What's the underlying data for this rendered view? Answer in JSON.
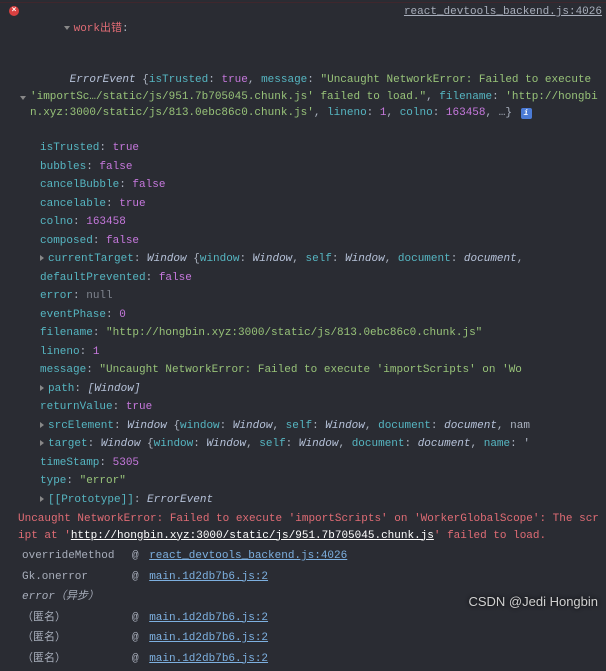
{
  "header": {
    "title": "work出错",
    "source_link": "react_devtools_backend.js:4026"
  },
  "summary": {
    "type_name": "ErrorEvent",
    "inline": "{isTrusted: true, message: \"Uncaught NetworkError: Failed to execute 'importSc…/static/js/951.7b705045.chunk.js' failed to load.\", filename: 'http://hongbin.xyz:3000/static/js/813.0ebc86c0.chunk.js', lineno: 1, colno: 163458, …}"
  },
  "props": {
    "isTrusted": "true",
    "bubbles": "false",
    "cancelBubble": "false",
    "cancelable": "true",
    "colno": "163458",
    "composed": "false",
    "currentTarget": "Window {window: Window, self: Window, document: document,",
    "defaultPrevented": "false",
    "error": "null",
    "eventPhase": "0",
    "filename": "\"http://hongbin.xyz:3000/static/js/813.0ebc86c0.chunk.js\"",
    "lineno": "1",
    "message": "\"Uncaught NetworkError: Failed to execute 'importScripts' on 'Wo",
    "path": "[Window]",
    "returnValue": "true",
    "srcElement": "Window {window: Window, self: Window, document: document, nam",
    "target": "Window {window: Window, self: Window, document: document, name: '",
    "timeStamp": "5305",
    "type": "\"error\""
  },
  "prototype": {
    "label": "[[Prototype]]",
    "value": "ErrorEvent"
  },
  "error_message": {
    "pre": "Uncaught NetworkError: Failed to execute 'importScripts' on 'WorkerGlobalScope': The script at '",
    "url": "http://hongbin.xyz:3000/static/js/951.7b705045.chunk.js",
    "post": "' failed to load."
  },
  "stack": [
    {
      "fn": "overrideMethod",
      "at": "@",
      "loc": "react_devtools_backend.js:4026",
      "ital": false
    },
    {
      "fn": "Gk.onerror",
      "at": "@",
      "loc": "main.1d2db7b6.js:2",
      "ital": false
    },
    {
      "fn": "error（异步）",
      "at": "",
      "loc": "",
      "ital": true
    },
    {
      "fn": "（匿名）",
      "at": "@",
      "loc": "main.1d2db7b6.js:2",
      "ital": false
    },
    {
      "fn": "（匿名）",
      "at": "@",
      "loc": "main.1d2db7b6.js:2",
      "ital": false
    },
    {
      "fn": "（匿名）",
      "at": "@",
      "loc": "main.1d2db7b6.js:2",
      "ital": false
    }
  ],
  "watermark": "CSDN @Jedi Hongbin"
}
